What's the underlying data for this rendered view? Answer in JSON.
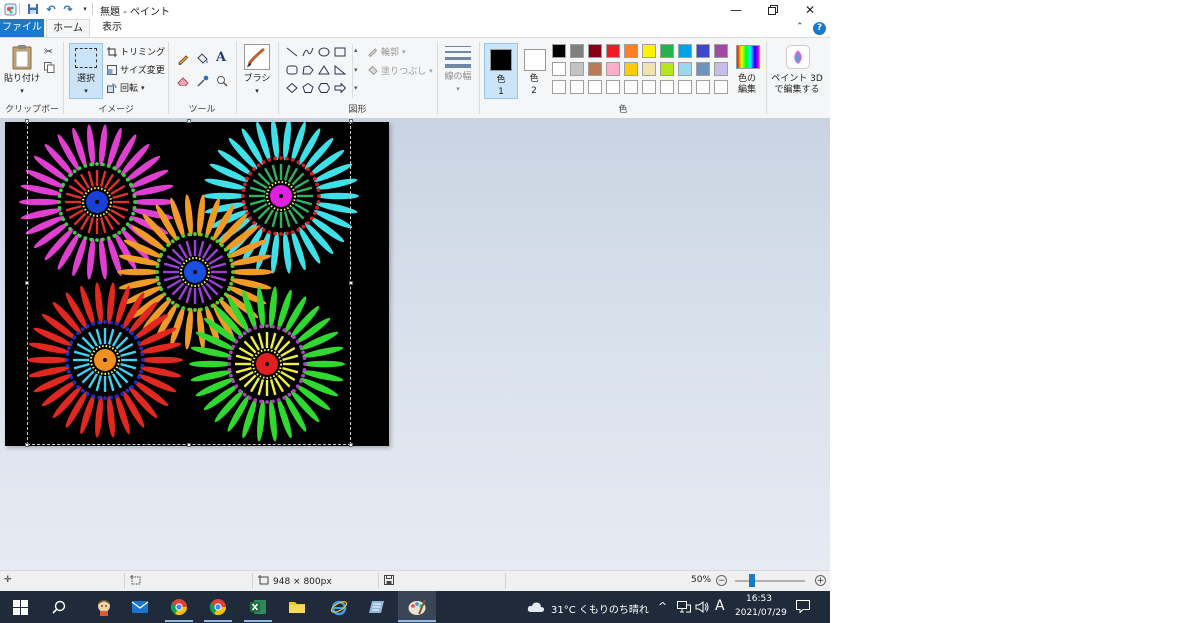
{
  "window": {
    "title": "無題 - ペイント"
  },
  "tabs": {
    "file": "ファイル",
    "home": "ホーム",
    "view": "表示"
  },
  "clipboard": {
    "paste": "貼り付け",
    "group": "クリップボード"
  },
  "image": {
    "select": "選択",
    "crop": "トリミング",
    "resize": "サイズ変更",
    "rotate": "回転",
    "group": "イメージ"
  },
  "tools": {
    "group": "ツール"
  },
  "brushes": {
    "label": "ブラシ"
  },
  "shapes": {
    "outline": "輪郭",
    "fill": "塗りつぶし",
    "group": "図形"
  },
  "size": {
    "label": "線の幅"
  },
  "colors": {
    "color1": "色",
    "color1_num": "1",
    "color2": "色",
    "color2_num": "2",
    "edit_line1": "色の",
    "edit_line2": "編集",
    "group": "色",
    "color1_value": "#000000",
    "color2_value": "#ffffff",
    "palette_row1": [
      "#000000",
      "#7f7f7f",
      "#880015",
      "#ed1c24",
      "#ff7f27",
      "#fff200",
      "#22b14c",
      "#00a2e8",
      "#3f48cc",
      "#a349a4"
    ],
    "palette_row2": [
      "#ffffff",
      "#c3c3c3",
      "#b97a57",
      "#ffaec9",
      "#ffc90e",
      "#efe4b0",
      "#b5e61d",
      "#99d9ea",
      "#7092be",
      "#c8bfe7"
    ],
    "palette_row3": [
      "#ffffff",
      "#ffffff",
      "#ffffff",
      "#ffffff",
      "#ffffff",
      "#ffffff",
      "#ffffff",
      "#ffffff",
      "#ffffff",
      "#ffffff"
    ]
  },
  "paint3d": {
    "line1": "ペイント 3D",
    "line2": "で編集する"
  },
  "status": {
    "dimensions": "948 × 800px",
    "zoom": "50%"
  },
  "tray": {
    "weather": "31°C くもりのち晴れ",
    "time": "16:53",
    "date": "2021/07/29",
    "ime": "A"
  },
  "icons": {
    "app": "paint-app-icon",
    "save": "save-icon",
    "undo": "undo-icon",
    "redo": "redo-icon",
    "minimize": "minimize-icon",
    "restore": "restore-icon",
    "close": "close-icon",
    "help": "help-icon"
  }
}
